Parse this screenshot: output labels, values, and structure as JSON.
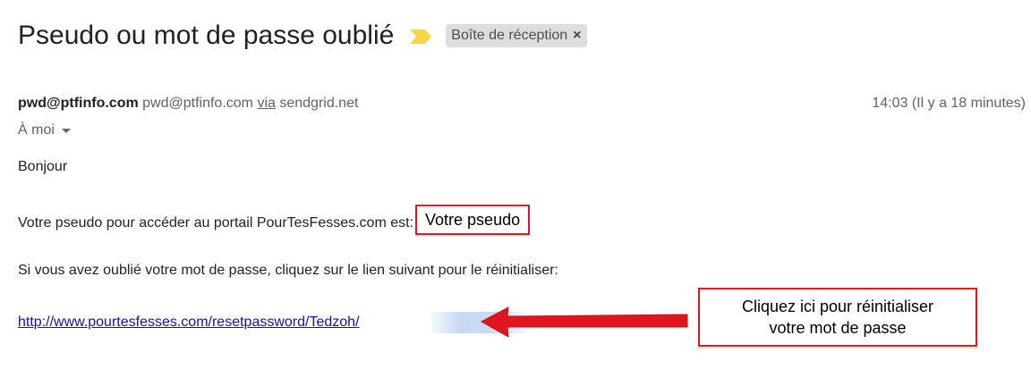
{
  "email": {
    "subject": "Pseudo ou mot de passe oublié",
    "label": "Boîte de réception",
    "label_close": "×",
    "sender_name": "pwd@ptfinfo.com",
    "sender_email": "pwd@ptfinfo.com",
    "via_label": "via",
    "via_domain": "sendgrid.net",
    "time": "14:03 (Il y a 18 minutes)",
    "recipient": "À moi",
    "body": {
      "greeting": "Bonjour",
      "pseudo_prefix": "Votre pseudo pour accéder au portail PourTesFesses.com est:",
      "pseudo_value": "Votre pseudo",
      "forgot_text": "Si vous avez oublié votre mot de passe, cliquez sur le lien suivant pour le réinitialiser:",
      "reset_link": "http://www.pourtesfesses.com/resetpassword/Tedzoh/"
    }
  },
  "annotation": {
    "callout_line1": "Cliquez ici pour réinitialiser",
    "callout_line2": "votre mot de passe",
    "color": "#e0151f"
  },
  "colors": {
    "link": "#1a0dab",
    "importance_marker": "#f7d54a",
    "label_chip_bg": "#dddddd"
  },
  "icons": {
    "importance": "importance-marker-icon",
    "dropdown": "chevron-down-icon",
    "arrow": "red-arrow-icon"
  }
}
